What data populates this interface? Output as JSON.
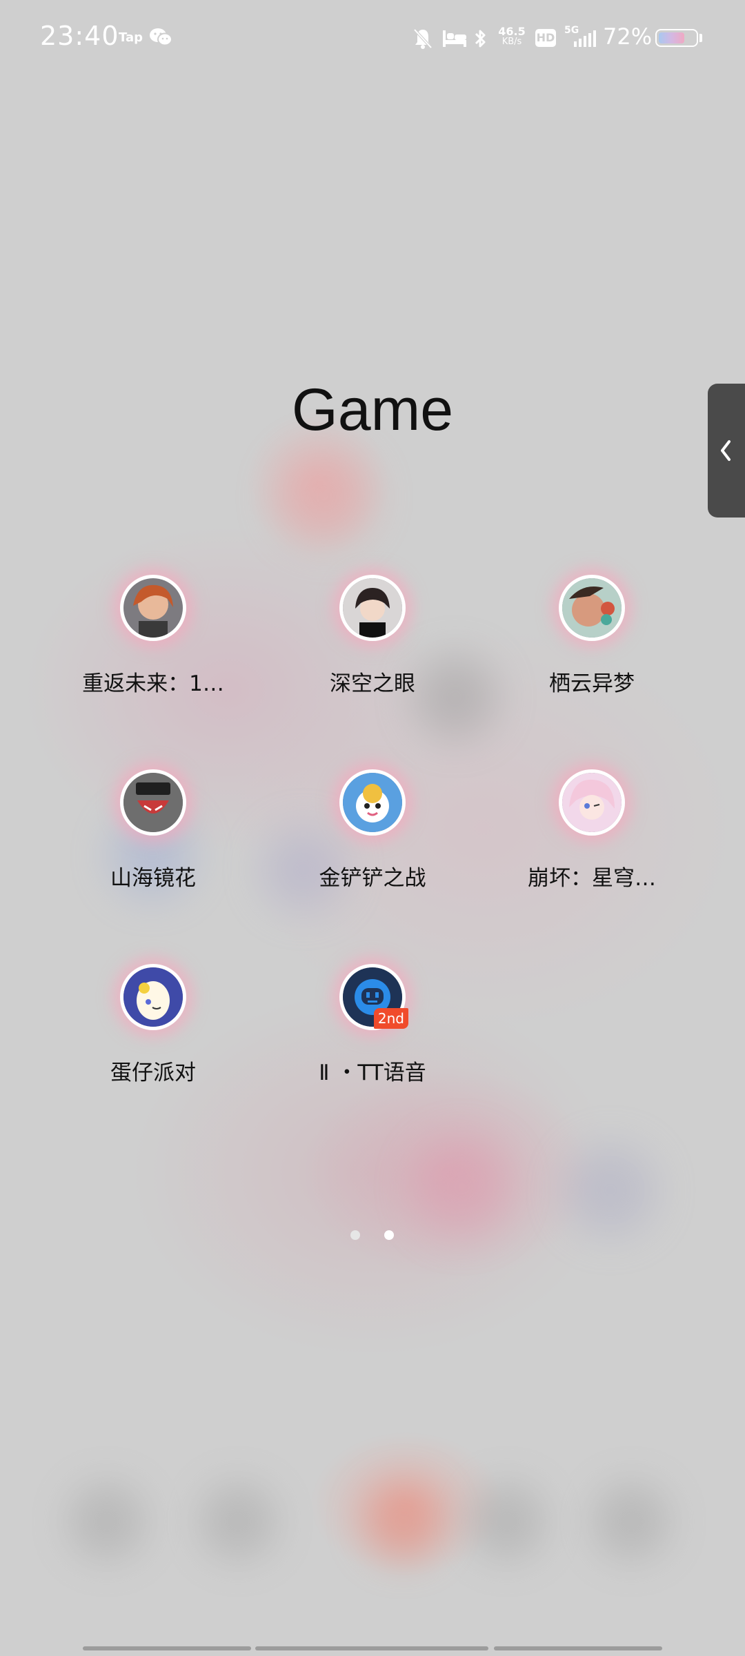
{
  "status_bar": {
    "time": "23:40",
    "notification_app": "Tap",
    "network_speed_value": "46.5",
    "network_speed_unit": "KB/s",
    "hd_label": "HD",
    "network_type": "5G",
    "battery_percent": "72%",
    "battery_level": 0.72
  },
  "folder": {
    "title": "Game",
    "apps": [
      {
        "label": "重返未来：1…",
        "icon": "reverse-1999-icon",
        "color": "#c66a3e"
      },
      {
        "label": "深空之眼",
        "icon": "aether-gazer-icon",
        "color": "#3b2f2f"
      },
      {
        "label": "栖云异梦",
        "icon": "qiyun-yimeng-icon",
        "color": "#c8866a"
      },
      {
        "label": "山海镜花",
        "icon": "shanhai-jinghua-icon",
        "color": "#2b2b2b"
      },
      {
        "label": "金铲铲之战",
        "icon": "golden-spatula-icon",
        "color": "#4a8fd8"
      },
      {
        "label": "崩坏：星穹…",
        "icon": "honkai-star-rail-icon",
        "color": "#e7b8d6"
      },
      {
        "label": "蛋仔派对",
        "icon": "eggy-party-icon",
        "color": "#6b78c8"
      },
      {
        "label": "Ⅱ ・TT语音",
        "icon": "tt-voice-icon",
        "color": "#1f3d6b",
        "badge": "2nd"
      }
    ]
  },
  "pager": {
    "pages": 2,
    "current": 2
  }
}
